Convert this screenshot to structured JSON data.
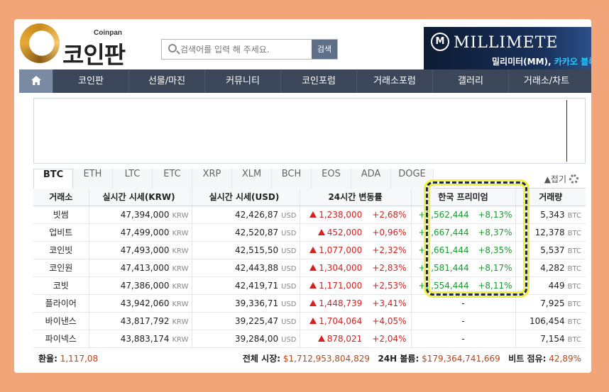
{
  "logo": {
    "sub": "Coinpan",
    "main": "코인판"
  },
  "search": {
    "placeholder": "검색어를 입력 해 주세요.",
    "button": "검색"
  },
  "banner": {
    "brand": "MILLIMETE",
    "sub_prefix": "밀리미터(MM),",
    "sub_highlight": "카카오 블록"
  },
  "nav": [
    "코인판",
    "선물/마진",
    "커뮤니티",
    "코인포럼",
    "거래소포럼",
    "갤러리",
    "거래소/차트"
  ],
  "tabs": [
    "BTC",
    "ETH",
    "LTC",
    "ETC",
    "XRP",
    "XLM",
    "BCH",
    "EOS",
    "ADA",
    "DOGE"
  ],
  "fold_label": "▲접기",
  "table": {
    "headers": [
      "거래소",
      "실시간 시세(KRW)",
      "실시간 시세(USD)",
      "24시간 변동률",
      "한국 프리미엄",
      "거래량"
    ],
    "units": {
      "krw": "KRW",
      "usd": "USD",
      "btc": "BTC"
    },
    "rows": [
      {
        "exchange": "빗썸",
        "krw": "47,394,000",
        "usd": "42,426,87",
        "chg": "1,238,000",
        "pct": "+2,68%",
        "prem": "+3,562,444",
        "prem_pct": "+8,13%",
        "vol": "5,343"
      },
      {
        "exchange": "업비트",
        "krw": "47,499,000",
        "usd": "42,520,87",
        "chg": "452,000",
        "pct": "+0,96%",
        "prem": "+3,667,444",
        "prem_pct": "+8,37%",
        "vol": "12,378"
      },
      {
        "exchange": "코인빗",
        "krw": "47,493,000",
        "usd": "42,515,50",
        "chg": "1,077,000",
        "pct": "+2,32%",
        "prem": "+3,661,444",
        "prem_pct": "+8,35%",
        "vol": "5,537"
      },
      {
        "exchange": "코인원",
        "krw": "47,413,000",
        "usd": "42,443,88",
        "chg": "1,304,000",
        "pct": "+2,83%",
        "prem": "+3,581,444",
        "prem_pct": "+8,17%",
        "vol": "4,282"
      },
      {
        "exchange": "코빗",
        "krw": "47,386,000",
        "usd": "42,419,71",
        "chg": "1,171,000",
        "pct": "+2,53%",
        "prem": "+3,554,444",
        "prem_pct": "+8,11%",
        "vol": "449"
      },
      {
        "exchange": "플라이어",
        "krw": "43,942,060",
        "usd": "39,336,71",
        "chg": "1,448,739",
        "pct": "+3,41%",
        "prem": "-",
        "prem_pct": "",
        "vol": "7,925"
      },
      {
        "exchange": "바이낸스",
        "krw": "43,817,792",
        "usd": "39,225,47",
        "chg": "1,704,064",
        "pct": "+4,05%",
        "prem": "-",
        "prem_pct": "",
        "vol": "106,454"
      },
      {
        "exchange": "파이넥스",
        "krw": "43,883,174",
        "usd": "39,284,00",
        "chg": "878,021",
        "pct": "+2,04%",
        "prem": "-",
        "prem_pct": "",
        "vol": "7,154"
      }
    ]
  },
  "footer": {
    "fx_label": "환율:",
    "fx_value": "1,117,08",
    "cap_label": "전체 시장:",
    "cap_value": "$1,712,953,804,829",
    "vol_label": "24H 볼륨:",
    "vol_value": "$179,364,741,669",
    "dom_label": "비트 점유:",
    "dom_value": "42,89%"
  }
}
